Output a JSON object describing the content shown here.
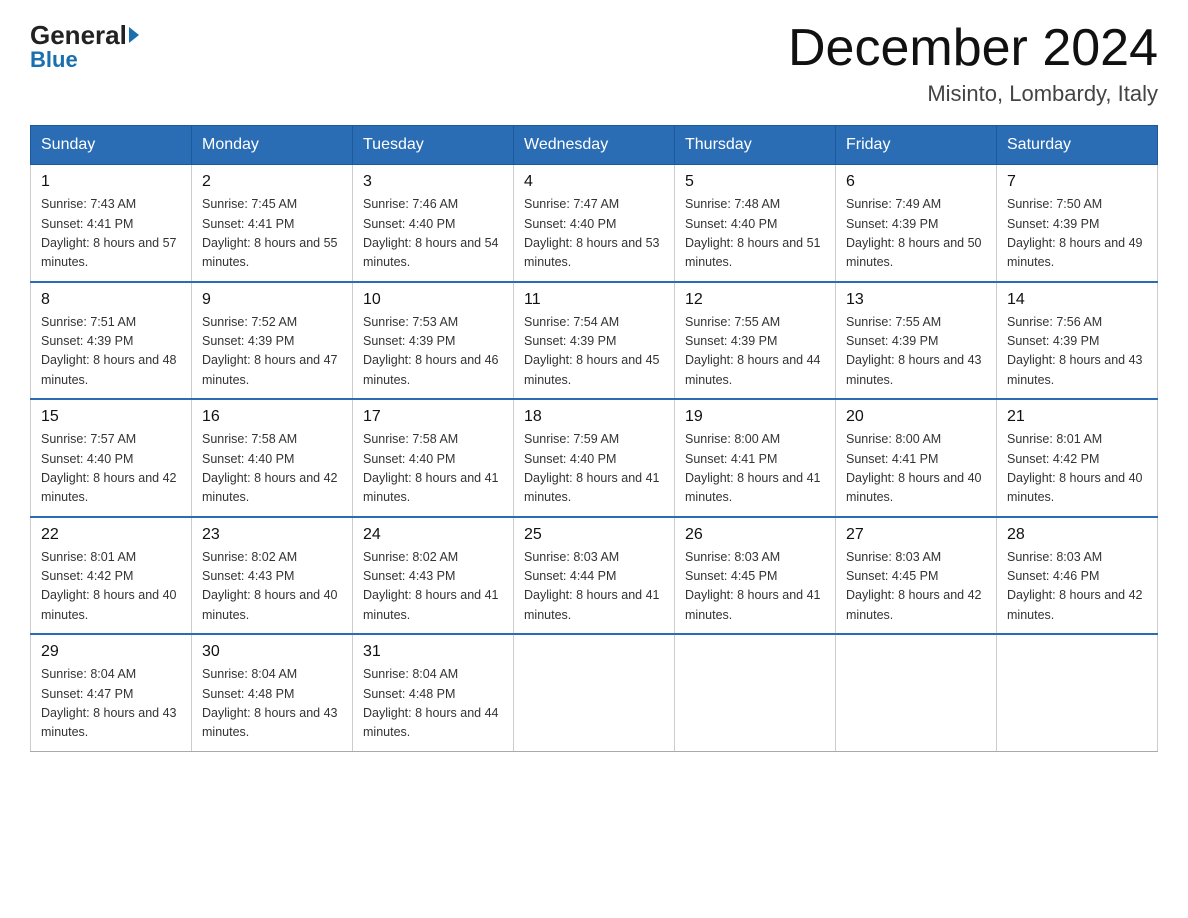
{
  "logo": {
    "line1": "General",
    "line2": "Blue"
  },
  "title": "December 2024",
  "subtitle": "Misinto, Lombardy, Italy",
  "days_of_week": [
    "Sunday",
    "Monday",
    "Tuesday",
    "Wednesday",
    "Thursday",
    "Friday",
    "Saturday"
  ],
  "weeks": [
    [
      {
        "day": "1",
        "sunrise": "Sunrise: 7:43 AM",
        "sunset": "Sunset: 4:41 PM",
        "daylight": "Daylight: 8 hours and 57 minutes."
      },
      {
        "day": "2",
        "sunrise": "Sunrise: 7:45 AM",
        "sunset": "Sunset: 4:41 PM",
        "daylight": "Daylight: 8 hours and 55 minutes."
      },
      {
        "day": "3",
        "sunrise": "Sunrise: 7:46 AM",
        "sunset": "Sunset: 4:40 PM",
        "daylight": "Daylight: 8 hours and 54 minutes."
      },
      {
        "day": "4",
        "sunrise": "Sunrise: 7:47 AM",
        "sunset": "Sunset: 4:40 PM",
        "daylight": "Daylight: 8 hours and 53 minutes."
      },
      {
        "day": "5",
        "sunrise": "Sunrise: 7:48 AM",
        "sunset": "Sunset: 4:40 PM",
        "daylight": "Daylight: 8 hours and 51 minutes."
      },
      {
        "day": "6",
        "sunrise": "Sunrise: 7:49 AM",
        "sunset": "Sunset: 4:39 PM",
        "daylight": "Daylight: 8 hours and 50 minutes."
      },
      {
        "day": "7",
        "sunrise": "Sunrise: 7:50 AM",
        "sunset": "Sunset: 4:39 PM",
        "daylight": "Daylight: 8 hours and 49 minutes."
      }
    ],
    [
      {
        "day": "8",
        "sunrise": "Sunrise: 7:51 AM",
        "sunset": "Sunset: 4:39 PM",
        "daylight": "Daylight: 8 hours and 48 minutes."
      },
      {
        "day": "9",
        "sunrise": "Sunrise: 7:52 AM",
        "sunset": "Sunset: 4:39 PM",
        "daylight": "Daylight: 8 hours and 47 minutes."
      },
      {
        "day": "10",
        "sunrise": "Sunrise: 7:53 AM",
        "sunset": "Sunset: 4:39 PM",
        "daylight": "Daylight: 8 hours and 46 minutes."
      },
      {
        "day": "11",
        "sunrise": "Sunrise: 7:54 AM",
        "sunset": "Sunset: 4:39 PM",
        "daylight": "Daylight: 8 hours and 45 minutes."
      },
      {
        "day": "12",
        "sunrise": "Sunrise: 7:55 AM",
        "sunset": "Sunset: 4:39 PM",
        "daylight": "Daylight: 8 hours and 44 minutes."
      },
      {
        "day": "13",
        "sunrise": "Sunrise: 7:55 AM",
        "sunset": "Sunset: 4:39 PM",
        "daylight": "Daylight: 8 hours and 43 minutes."
      },
      {
        "day": "14",
        "sunrise": "Sunrise: 7:56 AM",
        "sunset": "Sunset: 4:39 PM",
        "daylight": "Daylight: 8 hours and 43 minutes."
      }
    ],
    [
      {
        "day": "15",
        "sunrise": "Sunrise: 7:57 AM",
        "sunset": "Sunset: 4:40 PM",
        "daylight": "Daylight: 8 hours and 42 minutes."
      },
      {
        "day": "16",
        "sunrise": "Sunrise: 7:58 AM",
        "sunset": "Sunset: 4:40 PM",
        "daylight": "Daylight: 8 hours and 42 minutes."
      },
      {
        "day": "17",
        "sunrise": "Sunrise: 7:58 AM",
        "sunset": "Sunset: 4:40 PM",
        "daylight": "Daylight: 8 hours and 41 minutes."
      },
      {
        "day": "18",
        "sunrise": "Sunrise: 7:59 AM",
        "sunset": "Sunset: 4:40 PM",
        "daylight": "Daylight: 8 hours and 41 minutes."
      },
      {
        "day": "19",
        "sunrise": "Sunrise: 8:00 AM",
        "sunset": "Sunset: 4:41 PM",
        "daylight": "Daylight: 8 hours and 41 minutes."
      },
      {
        "day": "20",
        "sunrise": "Sunrise: 8:00 AM",
        "sunset": "Sunset: 4:41 PM",
        "daylight": "Daylight: 8 hours and 40 minutes."
      },
      {
        "day": "21",
        "sunrise": "Sunrise: 8:01 AM",
        "sunset": "Sunset: 4:42 PM",
        "daylight": "Daylight: 8 hours and 40 minutes."
      }
    ],
    [
      {
        "day": "22",
        "sunrise": "Sunrise: 8:01 AM",
        "sunset": "Sunset: 4:42 PM",
        "daylight": "Daylight: 8 hours and 40 minutes."
      },
      {
        "day": "23",
        "sunrise": "Sunrise: 8:02 AM",
        "sunset": "Sunset: 4:43 PM",
        "daylight": "Daylight: 8 hours and 40 minutes."
      },
      {
        "day": "24",
        "sunrise": "Sunrise: 8:02 AM",
        "sunset": "Sunset: 4:43 PM",
        "daylight": "Daylight: 8 hours and 41 minutes."
      },
      {
        "day": "25",
        "sunrise": "Sunrise: 8:03 AM",
        "sunset": "Sunset: 4:44 PM",
        "daylight": "Daylight: 8 hours and 41 minutes."
      },
      {
        "day": "26",
        "sunrise": "Sunrise: 8:03 AM",
        "sunset": "Sunset: 4:45 PM",
        "daylight": "Daylight: 8 hours and 41 minutes."
      },
      {
        "day": "27",
        "sunrise": "Sunrise: 8:03 AM",
        "sunset": "Sunset: 4:45 PM",
        "daylight": "Daylight: 8 hours and 42 minutes."
      },
      {
        "day": "28",
        "sunrise": "Sunrise: 8:03 AM",
        "sunset": "Sunset: 4:46 PM",
        "daylight": "Daylight: 8 hours and 42 minutes."
      }
    ],
    [
      {
        "day": "29",
        "sunrise": "Sunrise: 8:04 AM",
        "sunset": "Sunset: 4:47 PM",
        "daylight": "Daylight: 8 hours and 43 minutes."
      },
      {
        "day": "30",
        "sunrise": "Sunrise: 8:04 AM",
        "sunset": "Sunset: 4:48 PM",
        "daylight": "Daylight: 8 hours and 43 minutes."
      },
      {
        "day": "31",
        "sunrise": "Sunrise: 8:04 AM",
        "sunset": "Sunset: 4:48 PM",
        "daylight": "Daylight: 8 hours and 44 minutes."
      },
      null,
      null,
      null,
      null
    ]
  ]
}
